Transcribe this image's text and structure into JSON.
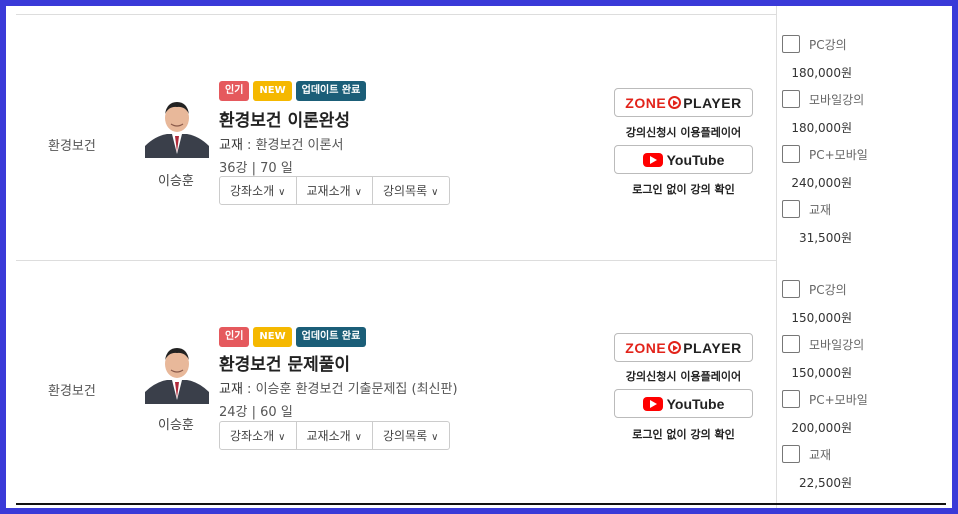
{
  "courses": [
    {
      "subject": "환경보건",
      "teacher": "이승훈",
      "badges": [
        "인기",
        "NEW",
        "업데이트 완료"
      ],
      "title": "환경보건 이론완성",
      "book_label": "교재",
      "book_sep": " : ",
      "book": "환경보건 이론서",
      "meta": "36강  |  70 일",
      "buttons": [
        "강좌소개",
        "교재소개",
        "강의목록"
      ],
      "player_brand_left": "ZONE",
      "player_brand_right": "PLAYER",
      "player_caption": "강의신청시 이용플레이어",
      "youtube_label": "YouTube",
      "youtube_caption": "로그인 없이 강의 확인",
      "options": [
        {
          "label": "PC강의",
          "price": "180,000원"
        },
        {
          "label": "모바일강의",
          "price": "180,000원"
        },
        {
          "label": "PC+모바일",
          "price": "240,000원"
        },
        {
          "label": "교재",
          "price": "31,500원"
        }
      ]
    },
    {
      "subject": "환경보건",
      "teacher": "이승훈",
      "badges": [
        "인기",
        "NEW",
        "업데이트 완료"
      ],
      "title": "환경보건 문제풀이",
      "book_label": "교재",
      "book_sep": " : ",
      "book": "이승훈 환경보건 기출문제집 (최신판)",
      "meta": "24강  |  60 일",
      "buttons": [
        "강좌소개",
        "교재소개",
        "강의목록"
      ],
      "player_brand_left": "ZONE",
      "player_brand_right": "PLAYER",
      "player_caption": "강의신청시 이용플레이어",
      "youtube_label": "YouTube",
      "youtube_caption": "로그인 없이 강의 확인",
      "options": [
        {
          "label": "PC강의",
          "price": "150,000원"
        },
        {
          "label": "모바일강의",
          "price": "150,000원"
        },
        {
          "label": "PC+모바일",
          "price": "200,000원"
        },
        {
          "label": "교재",
          "price": "22,500원"
        }
      ]
    }
  ],
  "icons": {
    "chevron": "chevron-down-icon",
    "zone_play": "play-circle-icon",
    "youtube": "youtube-icon"
  },
  "colors": {
    "frame": "#3a3ad8",
    "badge_hot": "#e5595d",
    "badge_new": "#f5b800",
    "badge_update": "#1b5e78",
    "zone_red": "#e2231a",
    "youtube_red": "#ff0000"
  }
}
